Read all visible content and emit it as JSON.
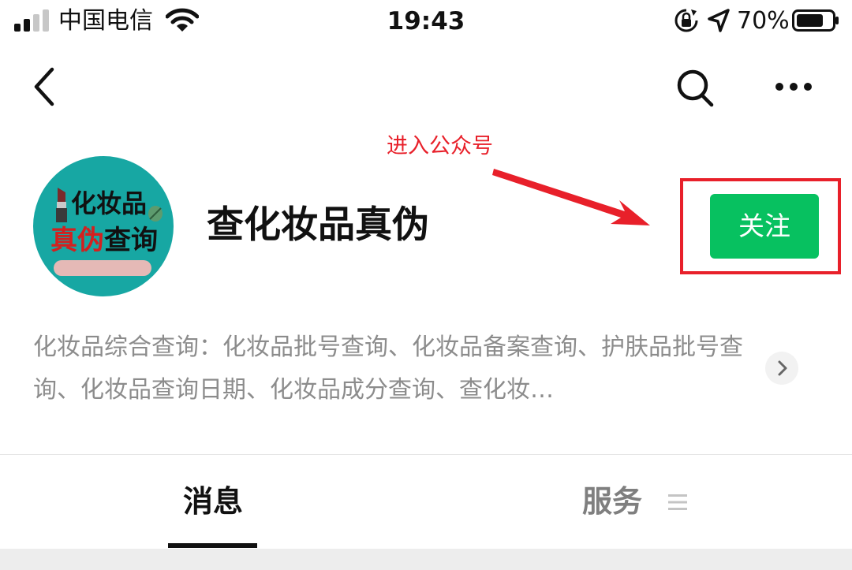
{
  "status_bar": {
    "carrier": "中国电信",
    "time": "19:43",
    "battery_percent": "70%",
    "icons": [
      "signal-icon",
      "wifi-icon",
      "rotation-lock-icon",
      "location-arrow-icon",
      "battery-icon"
    ]
  },
  "nav": {
    "icons": [
      "back-chevron-icon",
      "search-icon",
      "more-dots-icon"
    ]
  },
  "annotation": {
    "text": "进入公众号",
    "color": "#e8202a"
  },
  "profile": {
    "avatar_line1": "化妆品",
    "avatar_line2_red": "真伪",
    "avatar_line2_dark": "查询",
    "name": "查化妆品真伪",
    "follow_label": "关注"
  },
  "description": {
    "text": "化妆品综合查询：化妆品批号查询、化妆品备案查询、护肤品批号查询、化妆品查询日期、化妆品成分查询、查化妆…"
  },
  "tabs": {
    "messages": "消息",
    "services": "服务"
  },
  "colors": {
    "accent_green": "#07c160",
    "annotation_red": "#e8202a",
    "avatar_teal": "#17a7a3"
  }
}
